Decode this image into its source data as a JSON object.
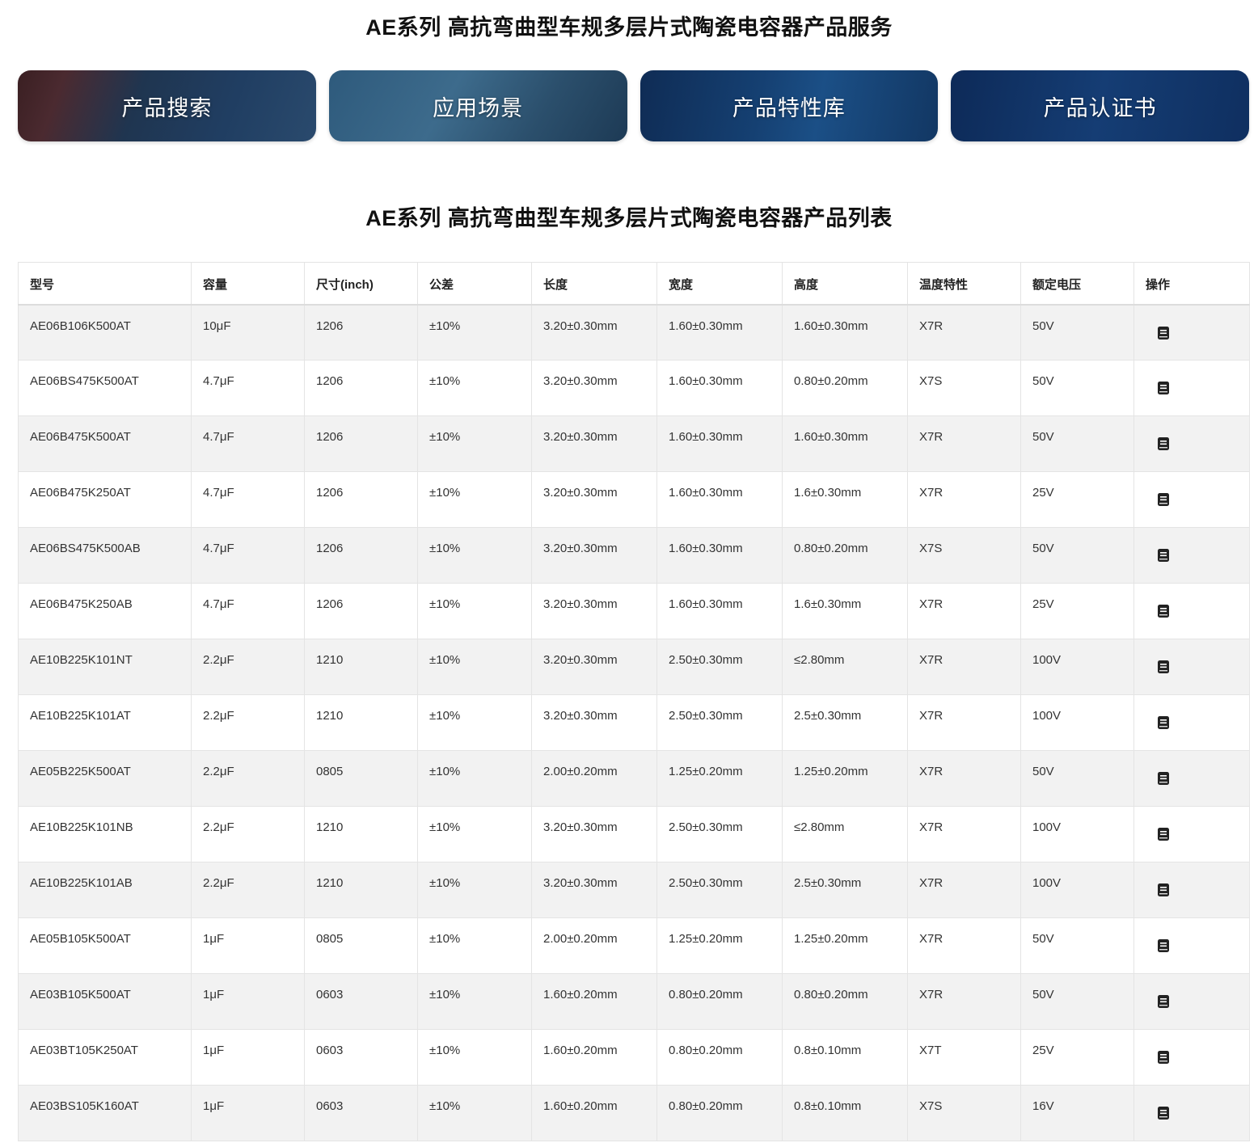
{
  "service_title": "AE系列 高抗弯曲型车规多层片式陶瓷电容器产品服务",
  "cards": [
    {
      "label": "产品搜索"
    },
    {
      "label": "应用场景"
    },
    {
      "label": "产品特性库"
    },
    {
      "label": "产品认证书"
    }
  ],
  "list_title": "AE系列 高抗弯曲型车规多层片式陶瓷电容器产品列表",
  "table": {
    "headers": [
      "型号",
      "容量",
      "尺寸(inch)",
      "公差",
      "长度",
      "宽度",
      "高度",
      "温度特性",
      "额定电压",
      "操作"
    ],
    "rows": [
      [
        "AE06B106K500AT",
        "10μF",
        "1206",
        "±10%",
        "3.20±0.30mm",
        "1.60±0.30mm",
        "1.60±0.30mm",
        "X7R",
        "50V"
      ],
      [
        "AE06BS475K500AT",
        "4.7μF",
        "1206",
        "±10%",
        "3.20±0.30mm",
        "1.60±0.30mm",
        "0.80±0.20mm",
        "X7S",
        "50V"
      ],
      [
        "AE06B475K500AT",
        "4.7μF",
        "1206",
        "±10%",
        "3.20±0.30mm",
        "1.60±0.30mm",
        "1.60±0.30mm",
        "X7R",
        "50V"
      ],
      [
        "AE06B475K250AT",
        "4.7μF",
        "1206",
        "±10%",
        "3.20±0.30mm",
        "1.60±0.30mm",
        "1.6±0.30mm",
        "X7R",
        "25V"
      ],
      [
        "AE06BS475K500AB",
        "4.7μF",
        "1206",
        "±10%",
        "3.20±0.30mm",
        "1.60±0.30mm",
        "0.80±0.20mm",
        "X7S",
        "50V"
      ],
      [
        "AE06B475K250AB",
        "4.7μF",
        "1206",
        "±10%",
        "3.20±0.30mm",
        "1.60±0.30mm",
        "1.6±0.30mm",
        "X7R",
        "25V"
      ],
      [
        "AE10B225K101NT",
        "2.2μF",
        "1210",
        "±10%",
        "3.20±0.30mm",
        "2.50±0.30mm",
        "≤2.80mm",
        "X7R",
        "100V"
      ],
      [
        "AE10B225K101AT",
        "2.2μF",
        "1210",
        "±10%",
        "3.20±0.30mm",
        "2.50±0.30mm",
        "2.5±0.30mm",
        "X7R",
        "100V"
      ],
      [
        "AE05B225K500AT",
        "2.2μF",
        "0805",
        "±10%",
        "2.00±0.20mm",
        "1.25±0.20mm",
        "1.25±0.20mm",
        "X7R",
        "50V"
      ],
      [
        "AE10B225K101NB",
        "2.2μF",
        "1210",
        "±10%",
        "3.20±0.30mm",
        "2.50±0.30mm",
        "≤2.80mm",
        "X7R",
        "100V"
      ],
      [
        "AE10B225K101AB",
        "2.2μF",
        "1210",
        "±10%",
        "3.20±0.30mm",
        "2.50±0.30mm",
        "2.5±0.30mm",
        "X7R",
        "100V"
      ],
      [
        "AE05B105K500AT",
        "1μF",
        "0805",
        "±10%",
        "2.00±0.20mm",
        "1.25±0.20mm",
        "1.25±0.20mm",
        "X7R",
        "50V"
      ],
      [
        "AE03B105K500AT",
        "1μF",
        "0603",
        "±10%",
        "1.60±0.20mm",
        "0.80±0.20mm",
        "0.80±0.20mm",
        "X7R",
        "50V"
      ],
      [
        "AE03BT105K250AT",
        "1μF",
        "0603",
        "±10%",
        "1.60±0.20mm",
        "0.80±0.20mm",
        "0.8±0.10mm",
        "X7T",
        "25V"
      ],
      [
        "AE03BS105K160AT",
        "1μF",
        "0603",
        "±10%",
        "1.60±0.20mm",
        "0.80±0.20mm",
        "0.8±0.10mm",
        "X7S",
        "16V"
      ]
    ],
    "action_icon": "document-icon"
  }
}
